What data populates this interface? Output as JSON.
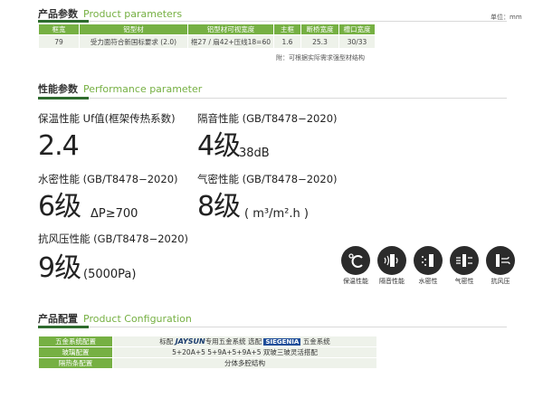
{
  "product_params": {
    "title_cn": "产品参数",
    "title_en": "Product parameters",
    "unit": "单位：mm",
    "headers": [
      "框宽",
      "铝型材",
      "铝型材可视宽度",
      "主框",
      "断桥宽度",
      "槽口宽度"
    ],
    "row": [
      "79",
      "受力面符合新国标要求 (2.0)",
      "框27 / 扇42+压线18=60",
      "1.6",
      "25.3",
      "30/33"
    ],
    "note": "附：可根据实际需求强型材结构"
  },
  "performance": {
    "title_cn": "性能参数",
    "title_en": "Performance parameter",
    "items": [
      {
        "label": "保温性能   Uf值(框架传热系数)",
        "value": "2.4",
        "unit": ""
      },
      {
        "label": "隔音性能   (GB/T8478−2020)",
        "value": "4级",
        "unit": "38dB"
      },
      {
        "label": "水密性能   (GB/T8478−2020)",
        "value": "6级",
        "unit": "ΔP≥700"
      },
      {
        "label": "气密性能   (GB/T8478−2020)",
        "value": "8级",
        "unit": "( m³/m².h )"
      },
      {
        "label": "抗风压性能  (GB/T8478−2020)",
        "value": "9级",
        "unit": "(5000Pa)"
      }
    ]
  },
  "icons": [
    {
      "name": "thermometer-celsius-icon",
      "label": "保温性能"
    },
    {
      "name": "sound-insulation-icon",
      "label": "隔音性能"
    },
    {
      "name": "water-tightness-icon",
      "label": "水密性"
    },
    {
      "name": "air-tightness-icon",
      "label": "气密性"
    },
    {
      "name": "wind-resistance-icon",
      "label": "抗风压"
    }
  ],
  "config": {
    "title_cn": "产品配置",
    "title_en": "Product Configuration",
    "rows": [
      {
        "key": "五金系统配置",
        "value_pre": "标配",
        "brand1": "JAYSUN",
        "value_mid": "专用五金系统  选配",
        "brand2": "SIEGENIA",
        "value_post": "五金系统"
      },
      {
        "key": "玻璃配置",
        "value": "5+20A+5    5+9A+5+9A+5 双玻三玻灵活搭配"
      },
      {
        "key": "隔热条配置",
        "value": "分体多腔结构"
      }
    ]
  },
  "colors": {
    "accent_green": "#76b043",
    "dark_green": "#2e6b2e",
    "cell_bg": "#eef2ea"
  }
}
